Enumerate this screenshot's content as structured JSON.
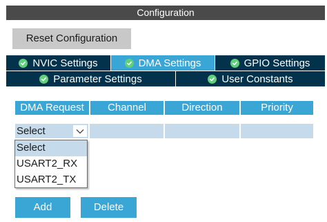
{
  "panel": {
    "title": "Configuration",
    "reset_label": "Reset Configuration"
  },
  "tabs": {
    "row1": [
      {
        "label": "NVIC Settings",
        "active": false
      },
      {
        "label": "DMA Settings",
        "active": true
      },
      {
        "label": "GPIO Settings",
        "active": false
      }
    ],
    "row2": [
      {
        "label": "Parameter Settings",
        "active": false
      },
      {
        "label": "User Constants",
        "active": false
      }
    ]
  },
  "table": {
    "columns": [
      "DMA Request",
      "Channel",
      "Direction",
      "Priority"
    ],
    "row": {
      "select_value": "Select"
    }
  },
  "dropdown": {
    "options": [
      "Select",
      "USART2_RX",
      "USART2_TX"
    ],
    "selected_index": 0
  },
  "actions": {
    "add_label": "Add",
    "delete_label": "Delete"
  },
  "colors": {
    "title_bar": "#4a4a4a",
    "tab_inactive": "#03324d",
    "tab_active": "#3aa6d6",
    "header": "#3aa6d6",
    "row": "#c5dbeb",
    "check": "#5fd17a",
    "reset_button": "#c8c8c8"
  }
}
